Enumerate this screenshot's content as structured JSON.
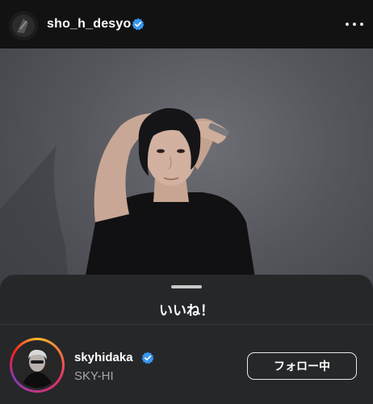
{
  "header": {
    "username": "sho_h_desyo",
    "verified_icon": "verified-badge-icon",
    "more_icon": "more-horizontal-icon"
  },
  "post": {
    "image": "photo-of-man-in-black-tshirt"
  },
  "likes_sheet": {
    "title": "いいね！",
    "users": [
      {
        "username": "skyhidaka",
        "full_name": "SKY-HI",
        "verified": true,
        "follow_button_label": "フォロー中"
      }
    ]
  },
  "colors": {
    "background": "#121212",
    "sheet": "#262729",
    "verified_blue": "#3897f0",
    "secondary_text": "#a8a8a8"
  }
}
